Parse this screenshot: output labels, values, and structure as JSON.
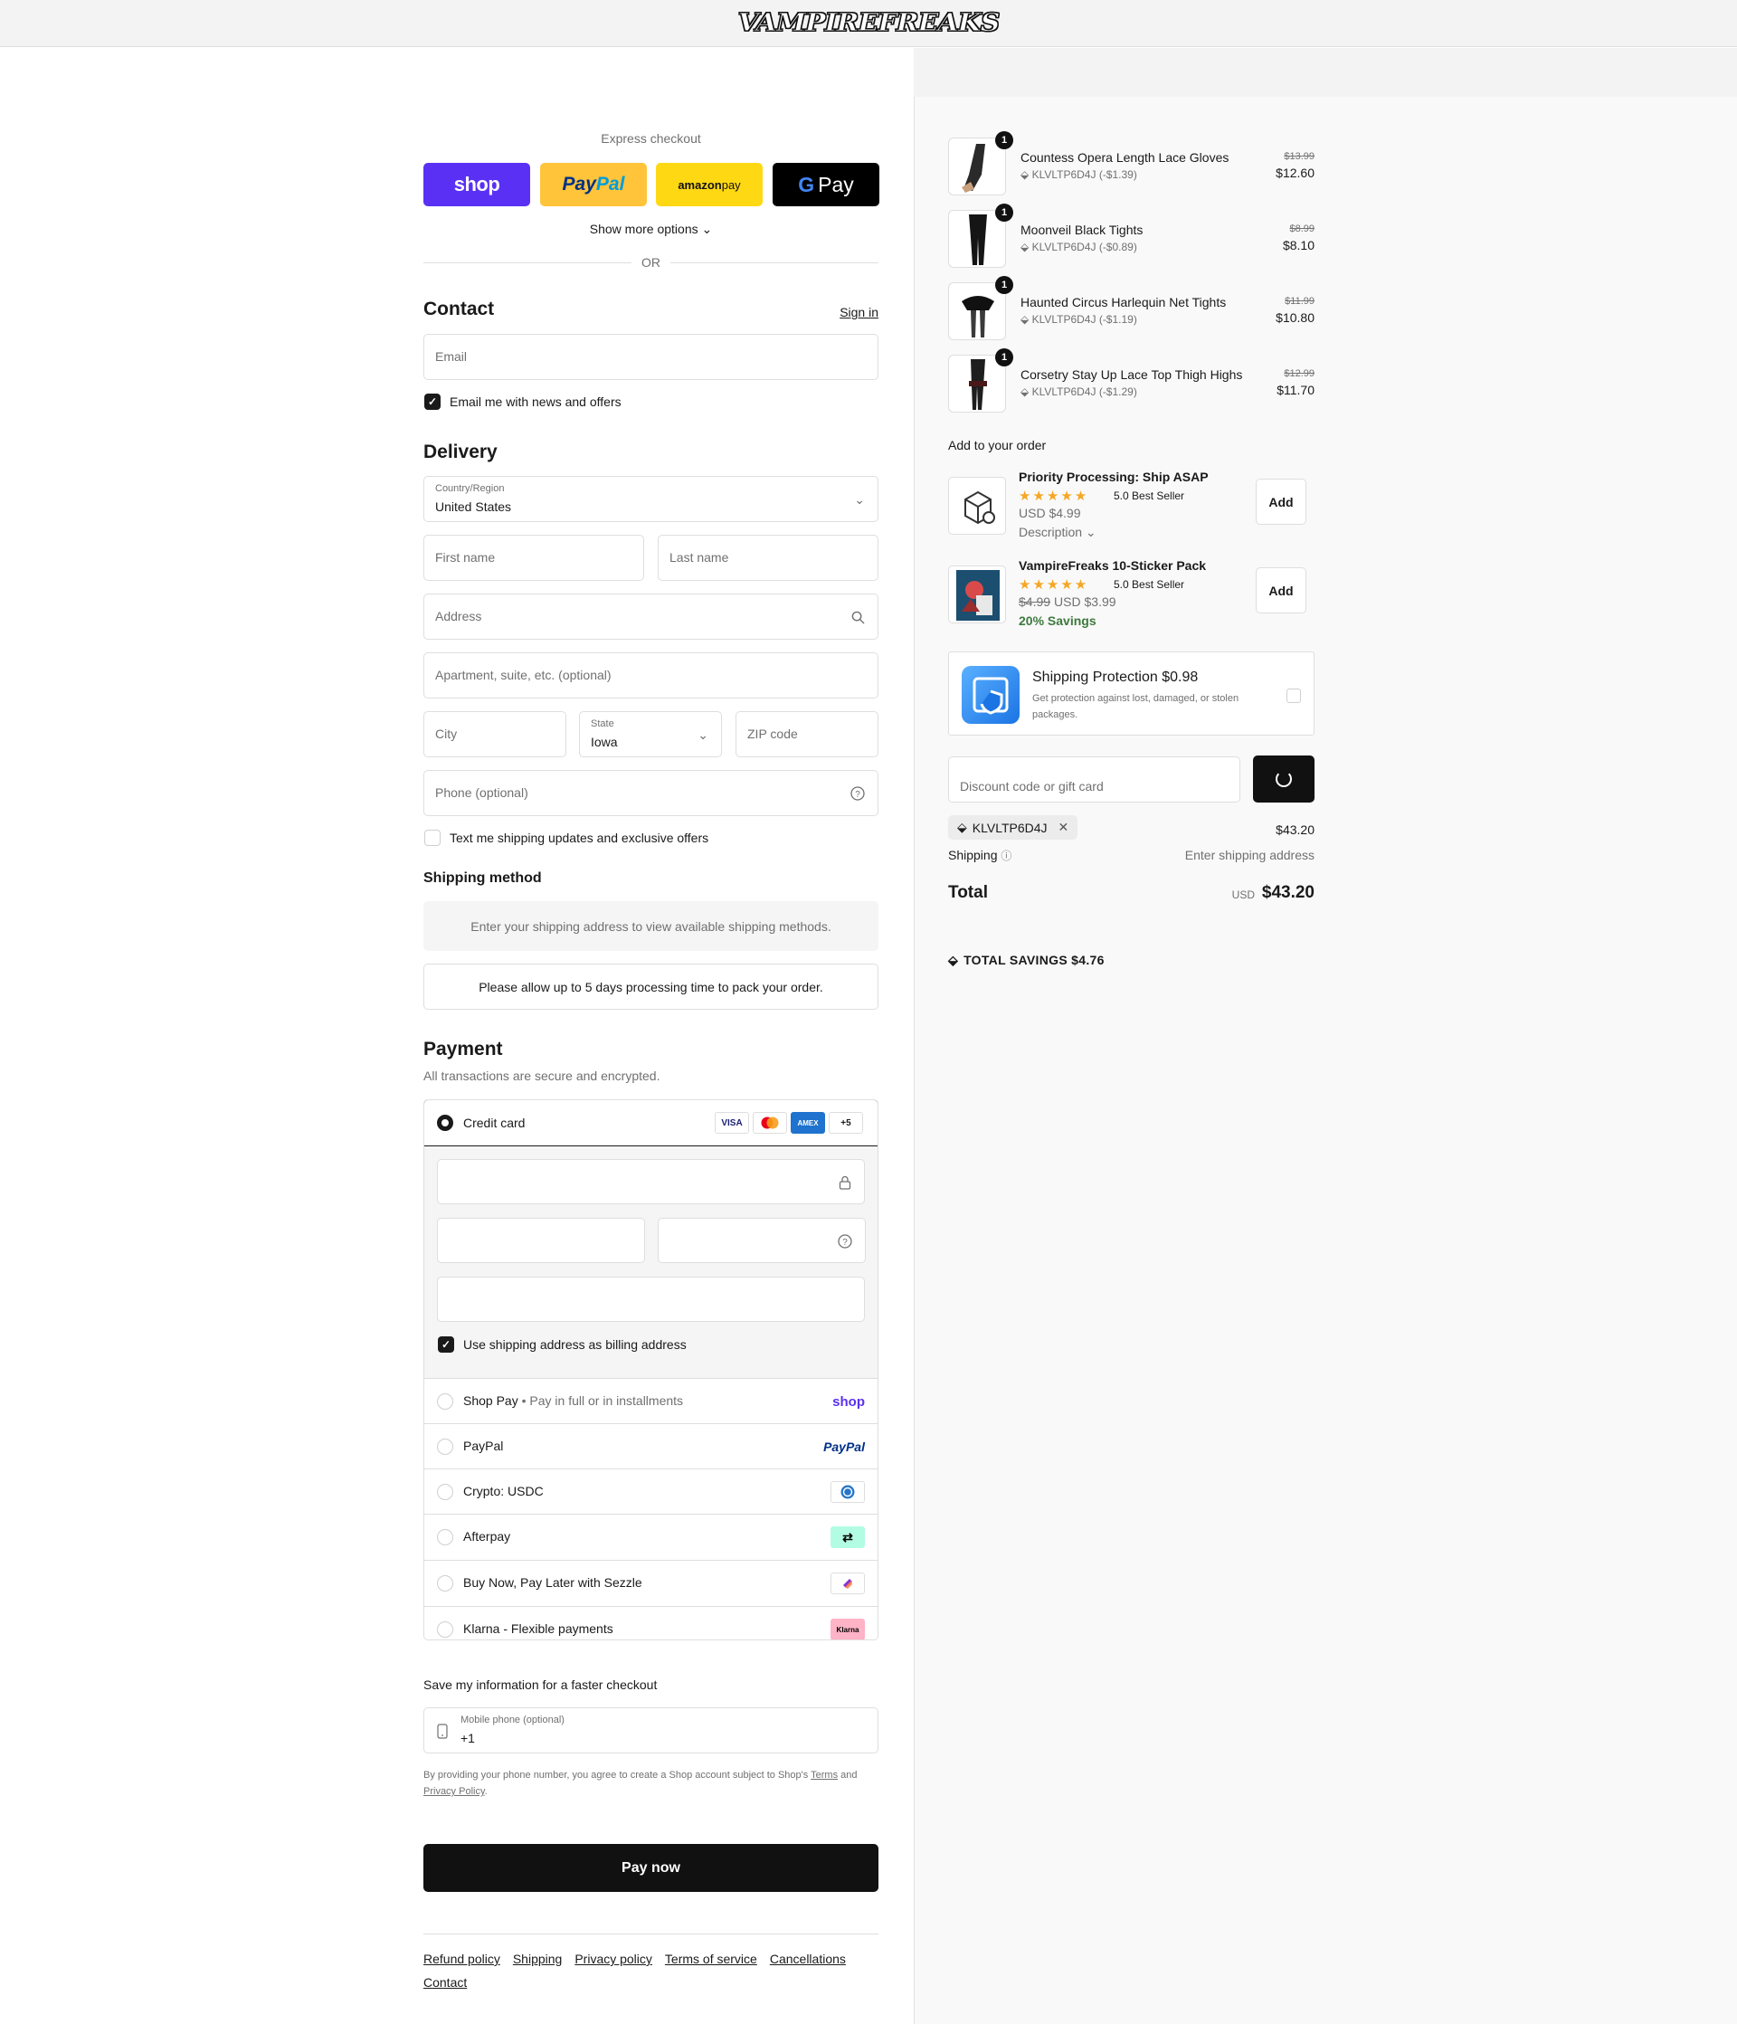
{
  "header": {
    "logo": "VAMPIREFREAKS"
  },
  "express": {
    "title": "Express checkout",
    "shop": "shop",
    "paypal_a": "Pay",
    "paypal_b": "Pal",
    "amazon_a": "amazon",
    "amazon_b": " pay",
    "gpay": "Pay",
    "show_more": "Show more options ⌄",
    "or": "OR"
  },
  "contact": {
    "heading": "Contact",
    "sign_in": "Sign in",
    "email_placeholder": "Email",
    "news_label": "Email me with news and offers"
  },
  "delivery": {
    "heading": "Delivery",
    "country_label": "Country/Region",
    "country_value": "United States",
    "first_name": "First name",
    "last_name": "Last name",
    "address": "Address",
    "apartment": "Apartment, suite, etc. (optional)",
    "city": "City",
    "state_label": "State",
    "state_value": "Iowa",
    "zip": "ZIP code",
    "phone": "Phone (optional)",
    "sms_label": "Text me shipping updates and exclusive offers"
  },
  "shipping_method": {
    "title": "Shipping method",
    "notice": "Enter your shipping address to view available shipping methods.",
    "processing": "Please allow up to 5 days processing time to pack your order."
  },
  "payment": {
    "heading": "Payment",
    "subtitle": "All transactions are secure and encrypted.",
    "credit_card": "Credit card",
    "cards": [
      "VISA",
      "MC",
      "AMEX",
      "+5"
    ],
    "billing_label": "Use shipping address as billing address",
    "options": [
      {
        "name": "Shop Pay",
        "sub": "Pay in full or in installments",
        "logo": "shop"
      },
      {
        "name": "PayPal",
        "sub": "",
        "logo": "PayPal"
      },
      {
        "name": "Crypto: USDC",
        "sub": "",
        "logo": "usdc"
      },
      {
        "name": "Afterpay",
        "sub": "",
        "logo": "afterpay"
      },
      {
        "name": "Buy Now, Pay Later with Sezzle",
        "sub": "",
        "logo": "sezzle"
      },
      {
        "name": "Klarna - Flexible payments",
        "sub": "",
        "logo": "Klarna"
      }
    ]
  },
  "save_info": {
    "title": "Save my information for a faster checkout",
    "phone_label": "Mobile phone (optional)",
    "phone_value": "+1",
    "legal_a": "By providing your phone number, you agree to create a Shop account subject to Shop's ",
    "legal_terms": "Terms",
    "legal_b": " and ",
    "legal_privacy": "Privacy Policy",
    "legal_c": "."
  },
  "pay_now": "Pay now",
  "footer": [
    "Refund policy",
    "Shipping",
    "Privacy policy",
    "Terms of service",
    "Cancellations",
    "Contact"
  ],
  "cart": {
    "items": [
      {
        "qty": "1",
        "title": "Countess Opera Length Lace Gloves",
        "discount": "KLVLTP6D4J (-$1.39)",
        "old": "$13.99",
        "new": "$12.60"
      },
      {
        "qty": "1",
        "title": "Moonveil Black Tights",
        "discount": "KLVLTP6D4J (-$0.89)",
        "old": "$8.99",
        "new": "$8.10"
      },
      {
        "qty": "1",
        "title": "Haunted Circus Harlequin Net Tights",
        "discount": "KLVLTP6D4J (-$1.19)",
        "old": "$11.99",
        "new": "$10.80"
      },
      {
        "qty": "1",
        "title": "Corsetry Stay Up Lace Top Thigh Highs",
        "discount": "KLVLTP6D4J (-$1.29)",
        "old": "$12.99",
        "new": "$11.70"
      }
    ],
    "add_title": "Add to your order",
    "upsells": [
      {
        "title": "Priority Processing: Ship ASAP",
        "stars": "★★★★★",
        "rating": "5.0  Best Seller",
        "old": "",
        "price": "USD $4.99",
        "extra": "Description ⌄",
        "add": "Add"
      },
      {
        "title": "VampireFreaks 10-Sticker Pack",
        "stars": "★★★★★",
        "rating": "5.0  Best Seller",
        "old": "$4.99",
        "price": "USD $3.99",
        "savings": "20% Savings",
        "add": "Add"
      }
    ],
    "protection": {
      "title": "Shipping Protection $0.98",
      "desc": "Get protection against lost, damaged, or stolen packages."
    },
    "discount_placeholder": "Discount code or gift card",
    "applied_code": "KLVLTP6D4J",
    "subtotal": "$43.20",
    "shipping_label": "Shipping",
    "shipping_value": "Enter shipping address",
    "total_label": "Total",
    "currency": "USD",
    "total": "$43.20",
    "savings": "TOTAL SAVINGS  $4.76"
  }
}
